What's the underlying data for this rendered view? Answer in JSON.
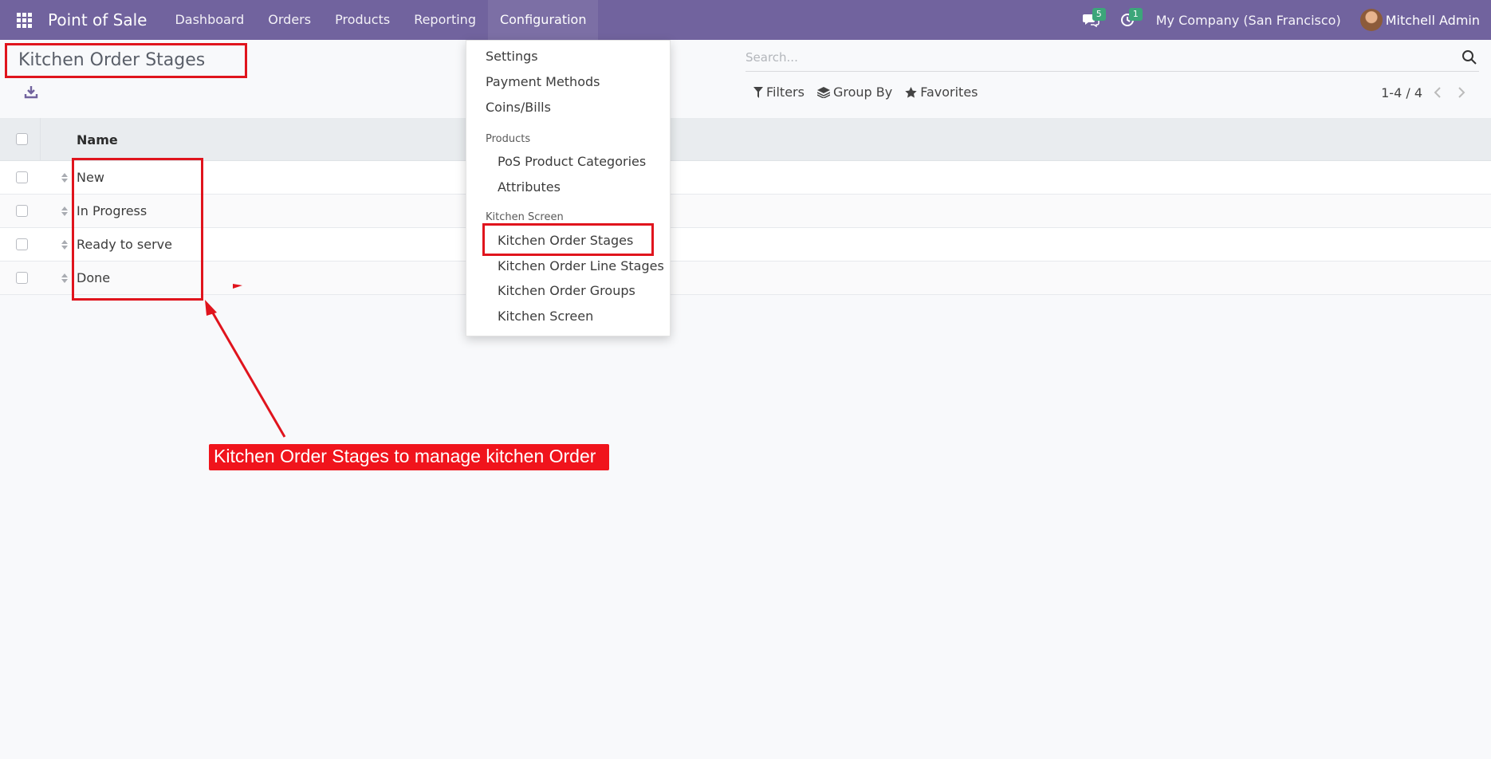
{
  "navbar": {
    "brand": "Point of Sale",
    "menu": [
      "Dashboard",
      "Orders",
      "Products",
      "Reporting",
      "Configuration"
    ],
    "messages_count": "5",
    "activities_count": "1",
    "company": "My Company (San Francisco)",
    "user": "Mitchell Admin",
    "color": "#71639e"
  },
  "control_panel": {
    "title": "Kitchen Order Stages",
    "search_placeholder": "Search...",
    "filters_label": "Filters",
    "groupby_label": "Group By",
    "favorites_label": "Favorites",
    "pager": "1-4 / 4"
  },
  "list": {
    "header_name": "Name",
    "rows": [
      "New",
      "In Progress",
      "Ready to serve",
      "Done"
    ]
  },
  "dropdown": {
    "items": [
      "Settings",
      "Payment Methods",
      "Coins/Bills"
    ],
    "section_products": "Products",
    "products_items": [
      "PoS Product Categories",
      "Attributes"
    ],
    "section_kitchen": "Kitchen Screen",
    "kitchen_items": [
      "Kitchen Order Stages",
      "Kitchen Order Line Stages",
      "Kitchen Order Groups",
      "Kitchen Screen"
    ]
  },
  "annotation": {
    "callout": "Kitchen Order Stages to manage kitchen Order",
    "color": "#e0141d"
  }
}
